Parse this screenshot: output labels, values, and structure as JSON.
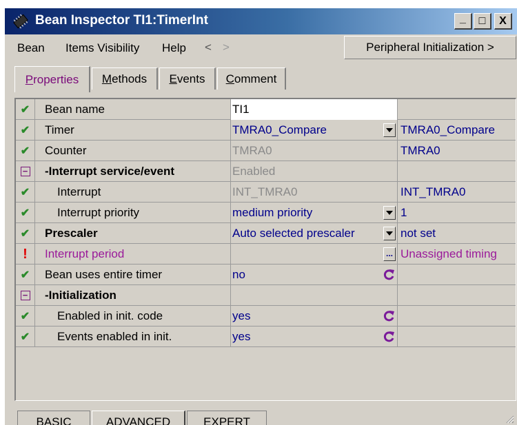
{
  "window": {
    "title": "Bean Inspector TI1:TimerInt",
    "controls": {
      "minimize": "_",
      "maximize": "□",
      "close": "X"
    }
  },
  "menu": {
    "items": [
      "Bean",
      "Items Visibility",
      "Help"
    ],
    "back_arrow": "<",
    "forward_arrow": ">",
    "peripheral_button": "Peripheral Initialization >"
  },
  "tabs": [
    {
      "label": "Properties",
      "ul": "P",
      "rest": "roperties",
      "active": true
    },
    {
      "label": "Methods",
      "ul": "M",
      "rest": "ethods",
      "active": false
    },
    {
      "label": "Events",
      "ul": "E",
      "rest": "vents",
      "active": false
    },
    {
      "label": "Comment",
      "ul": "C",
      "rest": "omment",
      "active": false
    }
  ],
  "rows": [
    {
      "icon": "check",
      "name": "Bean name",
      "value": "TI1",
      "value_style": "white",
      "real": ""
    },
    {
      "icon": "check",
      "name": "Timer",
      "value": "TMRA0_Compare",
      "control": "dropdown",
      "real": "TMRA0_Compare"
    },
    {
      "icon": "check",
      "name": "Counter",
      "value": "TMRA0",
      "value_style": "gray",
      "real": "TMRA0"
    },
    {
      "icon": "minus",
      "name": "-Interrupt service/event",
      "bold": true,
      "value": "Enabled",
      "value_style": "gray",
      "real": ""
    },
    {
      "icon": "check",
      "name": "Interrupt",
      "indent": true,
      "value": "INT_TMRA0",
      "value_style": "gray",
      "real": "INT_TMRA0"
    },
    {
      "icon": "check",
      "name": "Interrupt priority",
      "indent": true,
      "value": "medium priority",
      "control": "dropdown",
      "real": "1"
    },
    {
      "icon": "check",
      "name": "Prescaler",
      "bold": true,
      "value": "Auto selected prescaler",
      "control": "dropdown",
      "real": "not set"
    },
    {
      "icon": "error",
      "name": "Interrupt period",
      "error": true,
      "value": "",
      "control": "ellipsis",
      "real": "Unassigned timing"
    },
    {
      "icon": "check",
      "name": "Bean uses entire timer",
      "value": "no",
      "control": "reset",
      "real": ""
    },
    {
      "icon": "minus",
      "name": "-Initialization",
      "bold": true,
      "value": "",
      "real": ""
    },
    {
      "icon": "check",
      "name": "Enabled in init. code",
      "indent": true,
      "value": "yes",
      "control": "reset",
      "real": ""
    },
    {
      "icon": "check",
      "name": "Events enabled in init.",
      "indent": true,
      "value": "yes",
      "control": "reset",
      "real": ""
    }
  ],
  "bottom_tabs": [
    {
      "label": "BASIC",
      "active": false
    },
    {
      "label": "ADVANCED",
      "active": true
    },
    {
      "label": "EXPERT",
      "active": false
    }
  ],
  "colors": {
    "check": "#2a8a2a",
    "error": "#e00000",
    "value_text": "#00008b",
    "error_text": "#9a1a9a",
    "window_bg": "#d4d0c8"
  }
}
